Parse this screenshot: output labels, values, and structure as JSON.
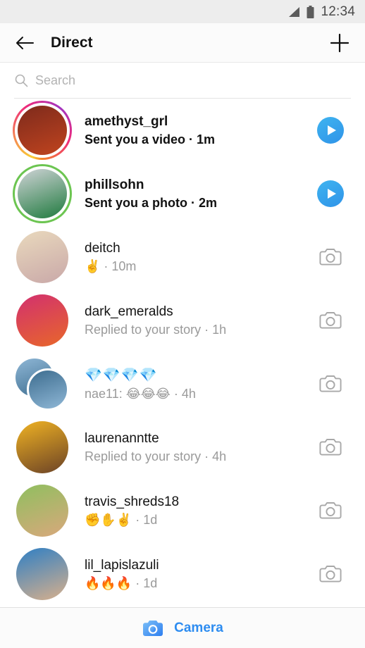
{
  "status_bar": {
    "time": "12:34",
    "signal_icon": "signal-icon",
    "battery_icon": "battery-icon"
  },
  "header": {
    "back_icon": "back-arrow-icon",
    "title": "Direct",
    "new_message_icon": "plus-icon"
  },
  "search": {
    "icon": "search-icon",
    "placeholder": "Search"
  },
  "threads": [
    {
      "username": "amethyst_grl",
      "preview": "Sent you a video · 1m",
      "unread": true,
      "ring": "gradient",
      "action_icon": "play-icon",
      "avatar_colors": [
        "#7d2a1c",
        "#c0441f"
      ]
    },
    {
      "username": "phillsohn",
      "preview": "Sent you a photo · 2m",
      "unread": true,
      "ring": "green",
      "action_icon": "play-icon",
      "avatar_colors": [
        "#cfd3d6",
        "#1f7a3e"
      ]
    },
    {
      "username": "deitch",
      "preview": "✌️ · 10m",
      "unread": false,
      "ring": "none",
      "action_icon": "camera-icon",
      "avatar_colors": [
        "#e9d9bd",
        "#c9a8a8"
      ]
    },
    {
      "username": "dark_emeralds",
      "preview": "Replied to your story · 1h",
      "unread": false,
      "ring": "none",
      "action_icon": "camera-icon",
      "avatar_colors": [
        "#d2306f",
        "#e8672a"
      ]
    },
    {
      "username": "💎💎💎💎",
      "preview": "nae11: 😂😂😂  · 4h",
      "unread": false,
      "ring": "none",
      "action_icon": "camera-icon",
      "group": true,
      "avatar_colors": [
        "#8fb7d6",
        "#3d6d8f"
      ]
    },
    {
      "username": "laurenanntte",
      "preview": "Replied to your story · 4h",
      "unread": false,
      "ring": "none",
      "action_icon": "camera-icon",
      "avatar_colors": [
        "#f0b323",
        "#6b4226"
      ]
    },
    {
      "username": "travis_shreds18",
      "preview": "✊✋✌️  · 1d",
      "unread": false,
      "ring": "none",
      "action_icon": "camera-icon",
      "avatar_colors": [
        "#8fbf5f",
        "#d9a87c"
      ]
    },
    {
      "username": "lil_lapislazuli",
      "preview": "🔥🔥🔥 · 1d",
      "unread": false,
      "ring": "none",
      "action_icon": "camera-icon",
      "avatar_colors": [
        "#2f7fc4",
        "#d8b08c"
      ]
    }
  ],
  "bottom_bar": {
    "camera_icon": "camera-icon",
    "label": "Camera",
    "accent_color": "#2d8cf0"
  }
}
